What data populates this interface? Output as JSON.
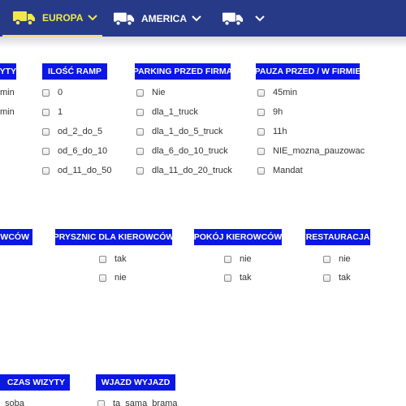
{
  "nav": {
    "tabs": [
      {
        "label": "EUROPA",
        "active": true,
        "icon": "truck-icon"
      },
      {
        "label": "AMERICA",
        "active": false,
        "icon": "truck-icon"
      },
      {
        "label": "",
        "active": false,
        "icon": "truck-icon"
      }
    ],
    "colors": {
      "bar": "#273a88",
      "active": "#f2e84b",
      "inactive": "#ffffff"
    }
  },
  "filters": {
    "row1": {
      "partial_header": "YTY",
      "partial_options": [
        "min",
        "min"
      ],
      "ilosc_ramp": {
        "header": "ILOŚĆ RAMP",
        "options": [
          "0",
          "1",
          "od_2_do_5",
          "od_6_do_10",
          "od_11_do_50"
        ]
      },
      "parking": {
        "header": "PARKING PRZED FIRMĄ",
        "options": [
          "Nie",
          "dla_1_truck",
          "dla_1_do_5_truck",
          "dla_6_do_10_truck",
          "dla_11_do_20_truck"
        ]
      },
      "pauza": {
        "header": "PAUZA PRZED / W FIRMIE",
        "options": [
          "45min",
          "9h",
          "11h",
          "NIE_mozna_pauzowac",
          "Mandat"
        ]
      }
    },
    "row2": {
      "partial_header": "ROWCÓW",
      "prysznic": {
        "header": "PRYSZNIC DLA KIEROWCÓW",
        "options": [
          "tak",
          "nie"
        ]
      },
      "pokoj": {
        "header": "POKÓJ KIEROWCÓW",
        "options": [
          "nie",
          "tak"
        ]
      },
      "restauracja": {
        "header": "RESTAURACJA",
        "options": [
          "nie",
          "tak"
        ]
      }
    },
    "row3": {
      "partial_header": "CZAS WIZYTY",
      "partial_options": [
        "soba"
      ],
      "wjazd": {
        "header": "WJAZD WYJAZD",
        "options": [
          "ta_sama_brama"
        ]
      }
    },
    "header_color": "#0b17e6"
  }
}
